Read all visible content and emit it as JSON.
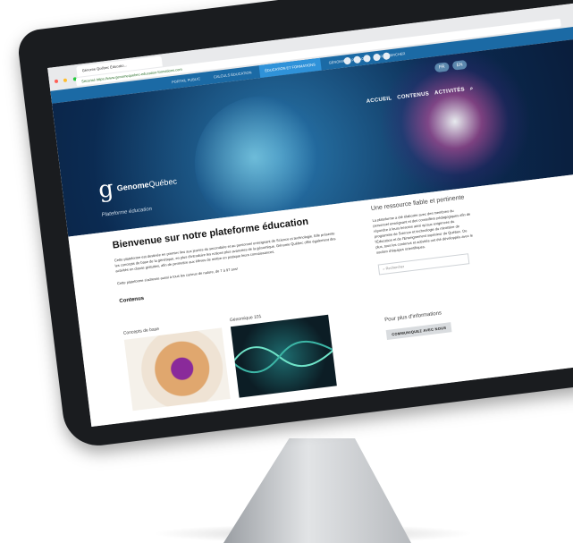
{
  "browser": {
    "tab_title": "Génome Québec Éducatio...",
    "url": "Sécurisé   https://www.genomequebec-education-formations.com"
  },
  "topnav": {
    "links": [
      "PORTAIL PUBLIC",
      "CALCULS ÉDUCATION",
      "ÉDUCATION ET FORMATIONS",
      "GÉNOMIQUE PÉDAGO",
      "RECHERCHER"
    ],
    "active_index": 2
  },
  "hero": {
    "lang_fr": "FR",
    "lang_en": "EN",
    "nav": [
      "ACCUEIL",
      "CONTENUS",
      "ACTIVITÉS"
    ],
    "brand_strong": "Genome",
    "brand_rest": "Québec",
    "subtitle": "Plateforme éducation"
  },
  "main": {
    "title": "Bienvenue sur notre plateforme éducation",
    "paragraph1": "Cette plateforme est destinée en premier lieu aux jeunes du secondaire et au personnel enseignant de Science et technologie. Elle présente les concepts de base de la génétique, en plus d'introduire les notions plus avancées de la génomique. Génome Québec offre également des activités en classe gratuites, afin de permettre aux élèves de mettre en pratique leurs connaissances.",
    "paragraph2": "Cette plateforme s'adresse aussi à tous les curieux de nature, de 7 à 97 ans!",
    "contents_heading": "Contenus",
    "card1_title": "Concepts de base",
    "card2_title": "Génomique 101"
  },
  "sidebar": {
    "title": "Une ressource fiable et pertinente",
    "paragraph": "La plateforme a été élaborée avec des membres du personnel enseignant et des conseillers pédagogiques afin de répondre à leurs besoins ainsi qu'aux exigences du programme de Science et technologie du ministère de l'Éducation et de l'Enseignement supérieur du Québec. De plus, tous les contenus et activités ont été développés avec le soutien d'équipes scientifiques.",
    "search_placeholder": "Rechercher",
    "info_title": "Pour plus d'informations",
    "contact_button": "COMMUNIQUEZ AVEC NOUS"
  },
  "colors": {
    "topnav": "#1b6aa5",
    "active_tab": "#2f92d9",
    "hero_dark": "#0b2b52"
  }
}
